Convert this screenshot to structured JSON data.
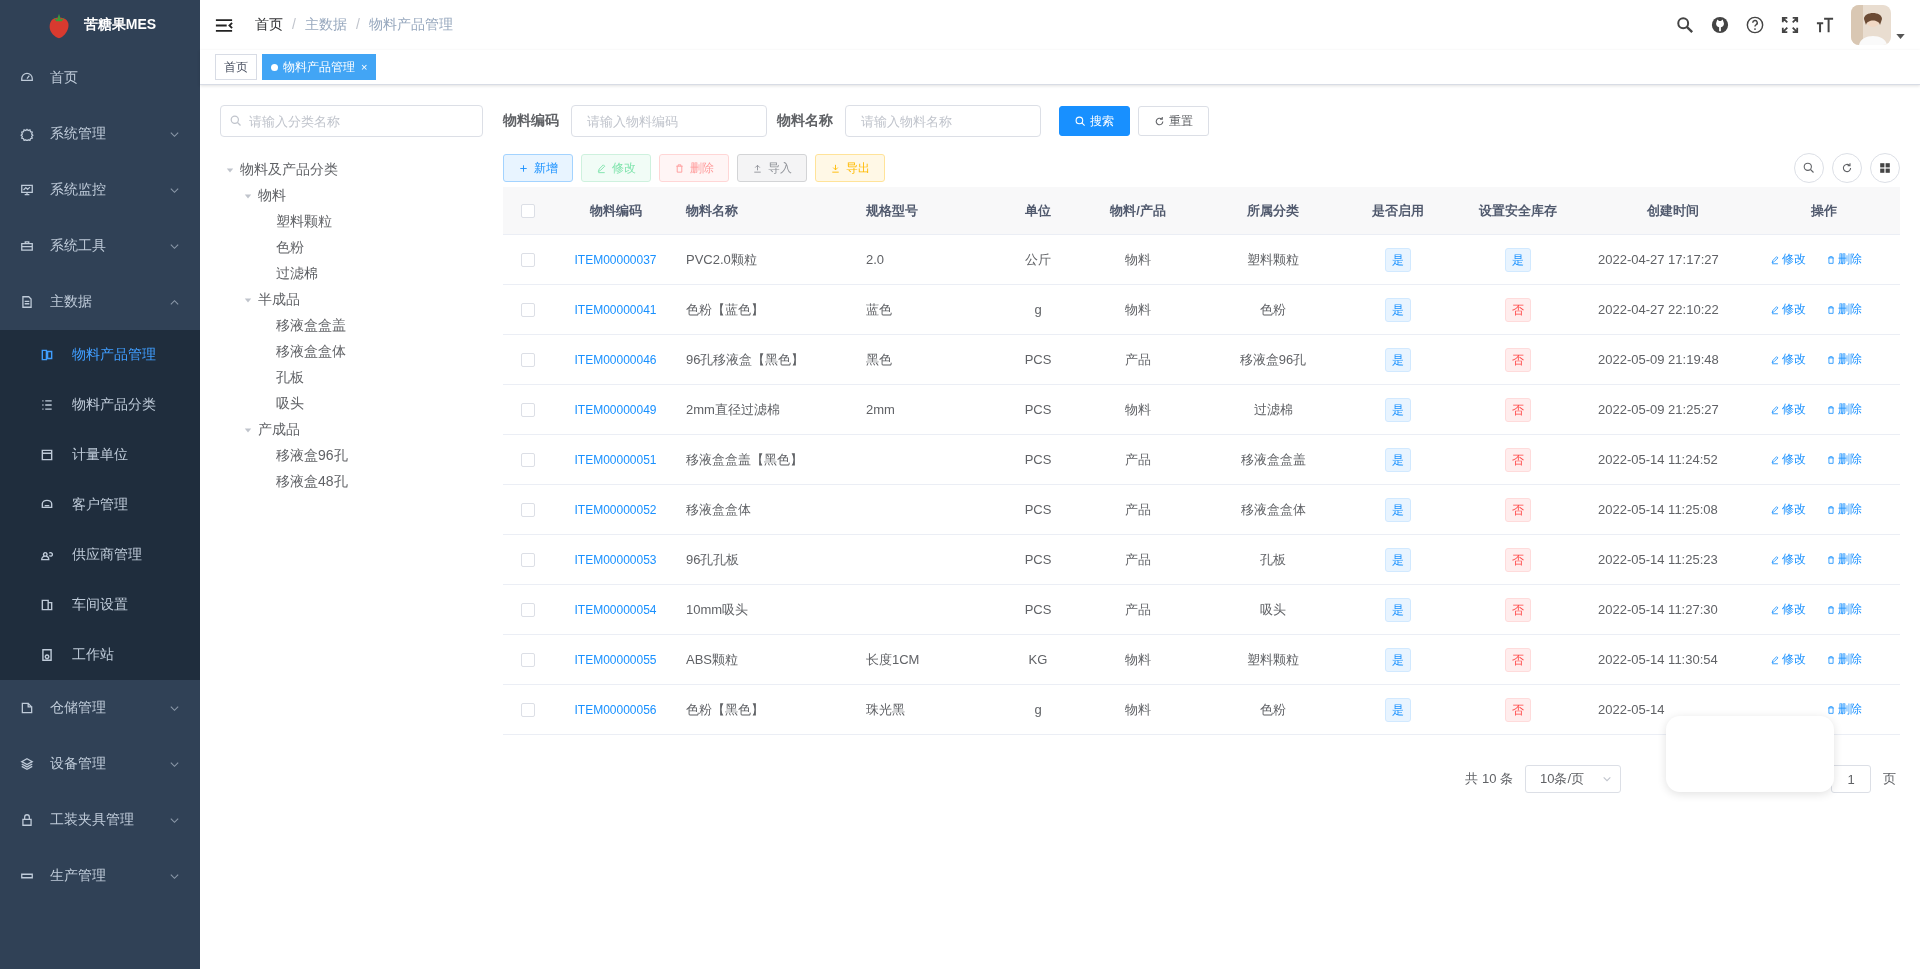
{
  "sidebar": {
    "logo_text": "苦糖果MES",
    "menu": [
      {
        "label": "首页"
      },
      {
        "label": "系统管理",
        "expanded": false
      },
      {
        "label": "系统监控",
        "expanded": false
      },
      {
        "label": "系统工具",
        "expanded": false
      },
      {
        "label": "主数据",
        "expanded": true,
        "children": [
          {
            "label": "物料产品管理",
            "selected": true
          },
          {
            "label": "物料产品分类",
            "selected": false
          },
          {
            "label": "计量单位",
            "selected": false
          },
          {
            "label": "客户管理",
            "selected": false
          },
          {
            "label": "供应商管理",
            "selected": false
          },
          {
            "label": "车间设置",
            "selected": false
          },
          {
            "label": "工作站",
            "selected": false
          }
        ]
      },
      {
        "label": "仓储管理",
        "expanded": false
      },
      {
        "label": "设备管理",
        "expanded": false
      },
      {
        "label": "工装夹具管理",
        "expanded": false
      },
      {
        "label": "生产管理",
        "expanded": false
      }
    ]
  },
  "breadcrumb": {
    "separator": "/",
    "items": [
      "首页",
      "主数据",
      "物料产品管理"
    ]
  },
  "tags": [
    {
      "label": "首页",
      "selected": false
    },
    {
      "label": "物料产品管理",
      "selected": true,
      "close": "×"
    }
  ],
  "tree": {
    "search": {
      "placeholder": "请输入分类名称"
    },
    "nodes": [
      {
        "label": "物料及产品分类",
        "expanded": true,
        "children": [
          {
            "label": "物料",
            "expanded": true,
            "children": [
              {
                "label": "塑料颗粒"
              },
              {
                "label": "色粉"
              },
              {
                "label": "过滤棉"
              }
            ]
          },
          {
            "label": "半成品",
            "expanded": true,
            "children": [
              {
                "label": "移液盒盒盖"
              },
              {
                "label": "移液盒盒体"
              },
              {
                "label": "孔板"
              },
              {
                "label": "吸头"
              }
            ]
          },
          {
            "label": "产成品",
            "expanded": true,
            "children": [
              {
                "label": "移液盒96孔"
              },
              {
                "label": "移液盒48孔"
              }
            ]
          }
        ]
      }
    ]
  },
  "search_form": {
    "fields": [
      {
        "label": "物料编码",
        "placeholder": "请输入物料编码"
      },
      {
        "label": "物料名称",
        "placeholder": "请输入物料名称"
      }
    ],
    "buttons": [
      {
        "label": "搜索",
        "kind": "primary"
      },
      {
        "label": "重置",
        "kind": "default"
      }
    ]
  },
  "toolbar": [
    {
      "label": "新增",
      "kind": "primary",
      "disabled": false
    },
    {
      "label": "修改",
      "kind": "success",
      "disabled": true
    },
    {
      "label": "删除",
      "kind": "danger",
      "disabled": true
    },
    {
      "label": "导入",
      "kind": "info",
      "disabled": false
    },
    {
      "label": "导出",
      "kind": "warning",
      "disabled": false
    }
  ],
  "table": {
    "header_checked": false,
    "columns": [
      "物料编码",
      "物料名称",
      "规格型号",
      "单位",
      "物料/产品",
      "所属分类",
      "是否启用",
      "设置安全库存",
      "创建时间",
      "操作"
    ],
    "rows": [
      {
        "checked": false,
        "code": "ITEM00000037",
        "name": "PVC2.0颗粒",
        "spec": "2.0",
        "unit": "公斤",
        "type": "物料",
        "category": "塑料颗粒",
        "enabled": {
          "label": "是",
          "on": true
        },
        "safety_stock": {
          "label": "是",
          "on": true
        },
        "created": "2022-04-27 17:17:27",
        "actions": [
          {
            "label": "修改",
            "kind": "edit"
          },
          {
            "label": "删除",
            "kind": "delete"
          }
        ]
      },
      {
        "checked": false,
        "code": "ITEM00000041",
        "name": "色粉【蓝色】",
        "spec": "蓝色",
        "unit": "g",
        "type": "物料",
        "category": "色粉",
        "enabled": {
          "label": "是",
          "on": true
        },
        "safety_stock": {
          "label": "否",
          "on": false
        },
        "created": "2022-04-27 22:10:22",
        "actions": [
          {
            "label": "修改",
            "kind": "edit"
          },
          {
            "label": "删除",
            "kind": "delete"
          }
        ]
      },
      {
        "checked": false,
        "code": "ITEM00000046",
        "name": "96孔移液盒【黑色】",
        "spec": "黑色",
        "unit": "PCS",
        "type": "产品",
        "category": "移液盒96孔",
        "enabled": {
          "label": "是",
          "on": true
        },
        "safety_stock": {
          "label": "否",
          "on": false
        },
        "created": "2022-05-09 21:19:48",
        "actions": [
          {
            "label": "修改",
            "kind": "edit"
          },
          {
            "label": "删除",
            "kind": "delete"
          }
        ]
      },
      {
        "checked": false,
        "code": "ITEM00000049",
        "name": "2mm直径过滤棉",
        "spec": "2mm",
        "unit": "PCS",
        "type": "物料",
        "category": "过滤棉",
        "enabled": {
          "label": "是",
          "on": true
        },
        "safety_stock": {
          "label": "否",
          "on": false
        },
        "created": "2022-05-09 21:25:27",
        "actions": [
          {
            "label": "修改",
            "kind": "edit"
          },
          {
            "label": "删除",
            "kind": "delete"
          }
        ]
      },
      {
        "checked": false,
        "code": "ITEM00000051",
        "name": "移液盒盒盖【黑色】",
        "unit": "PCS",
        "type": "产品",
        "category": "移液盒盒盖",
        "enabled": {
          "label": "是",
          "on": true
        },
        "safety_stock": {
          "label": "否",
          "on": false
        },
        "created": "2022-05-14 11:24:52",
        "actions": [
          {
            "label": "修改",
            "kind": "edit"
          },
          {
            "label": "删除",
            "kind": "delete"
          }
        ]
      },
      {
        "checked": false,
        "code": "ITEM00000052",
        "name": "移液盒盒体",
        "unit": "PCS",
        "type": "产品",
        "category": "移液盒盒体",
        "enabled": {
          "label": "是",
          "on": true
        },
        "safety_stock": {
          "label": "否",
          "on": false
        },
        "created": "2022-05-14 11:25:08",
        "actions": [
          {
            "label": "修改",
            "kind": "edit"
          },
          {
            "label": "删除",
            "kind": "delete"
          }
        ]
      },
      {
        "checked": false,
        "code": "ITEM00000053",
        "name": "96孔孔板",
        "unit": "PCS",
        "type": "产品",
        "category": "孔板",
        "enabled": {
          "label": "是",
          "on": true
        },
        "safety_stock": {
          "label": "否",
          "on": false
        },
        "created": "2022-05-14 11:25:23",
        "actions": [
          {
            "label": "修改",
            "kind": "edit"
          },
          {
            "label": "删除",
            "kind": "delete"
          }
        ]
      },
      {
        "checked": false,
        "code": "ITEM00000054",
        "name": "10mm吸头",
        "unit": "PCS",
        "type": "产品",
        "category": "吸头",
        "enabled": {
          "label": "是",
          "on": true
        },
        "safety_stock": {
          "label": "否",
          "on": false
        },
        "created": "2022-05-14 11:27:30",
        "actions": [
          {
            "label": "修改",
            "kind": "edit"
          },
          {
            "label": "删除",
            "kind": "delete"
          }
        ]
      },
      {
        "checked": false,
        "code": "ITEM00000055",
        "name": "ABS颗粒",
        "spec": "长度1CM",
        "unit": "KG",
        "type": "物料",
        "category": "塑料颗粒",
        "enabled": {
          "label": "是",
          "on": true
        },
        "safety_stock": {
          "label": "否",
          "on": false
        },
        "created": "2022-05-14 11:30:54",
        "actions": [
          {
            "label": "修改",
            "kind": "edit"
          },
          {
            "label": "删除",
            "kind": "delete"
          }
        ]
      },
      {
        "checked": false,
        "code": "ITEM00000056",
        "name": "色粉【黑色】",
        "spec": "珠光黑",
        "unit": "g",
        "type": "物料",
        "category": "色粉",
        "enabled": {
          "label": "是",
          "on": true
        },
        "safety_stock": {
          "label": "否",
          "on": false
        },
        "created": "2022-05-14",
        "actions": [
          {
            "label": "删除",
            "kind": "delete"
          }
        ]
      }
    ]
  },
  "pagination": {
    "total": "共 10 条",
    "page_size": "10条/页",
    "page": "1",
    "page_suffix": "页"
  }
}
